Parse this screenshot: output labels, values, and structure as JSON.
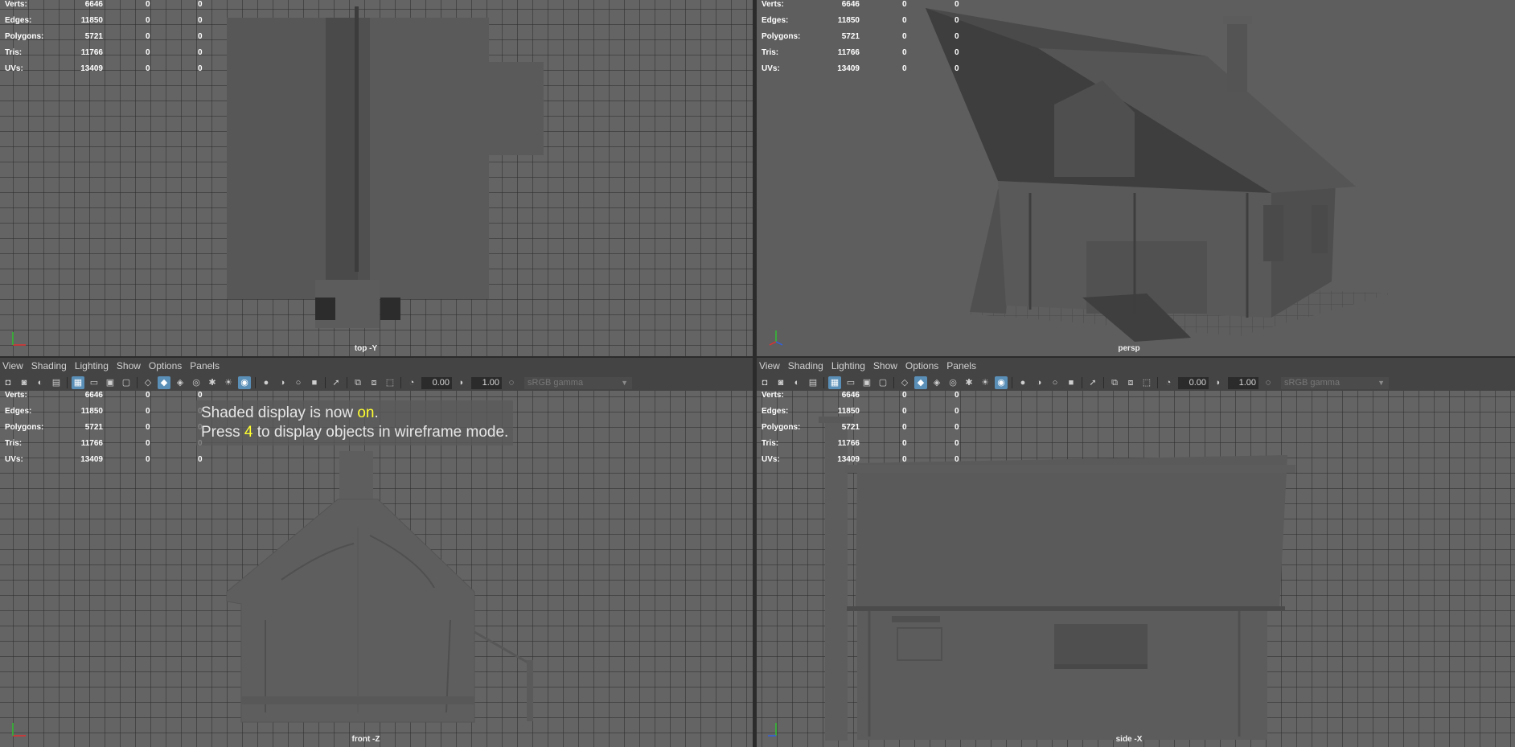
{
  "stats": {
    "rows": [
      {
        "label": "Verts:",
        "v1": "6646",
        "v2": "0",
        "v3": "0"
      },
      {
        "label": "Edges:",
        "v1": "11850",
        "v2": "0",
        "v3": "0"
      },
      {
        "label": "Polygons:",
        "v1": "5721",
        "v2": "0",
        "v3": "0"
      },
      {
        "label": "Tris:",
        "v1": "11766",
        "v2": "0",
        "v3": "0"
      },
      {
        "label": "UVs:",
        "v1": "13409",
        "v2": "0",
        "v3": "0"
      }
    ]
  },
  "viewports": {
    "top": {
      "camera_label": "top -Y"
    },
    "persp": {
      "camera_label": "persp"
    },
    "front": {
      "camera_label": "front -Z"
    },
    "side": {
      "camera_label": "side -X"
    }
  },
  "panel_menu": [
    "View",
    "Shading",
    "Lighting",
    "Show",
    "Options",
    "Panels"
  ],
  "toolbar": {
    "exposure": "0.00",
    "gamma": "1.00",
    "color_space": "sRGB gamma"
  },
  "notice": {
    "line1_prefix": "Shaded display is now ",
    "line1_highlight": "on",
    "line1_suffix": ".",
    "line2_prefix": "Press ",
    "line2_key": "4",
    "line2_suffix": " to display objects in wireframe mode."
  },
  "colors": {
    "active_button": "#5a8fb8",
    "notice_highlight": "#ffff30",
    "grid_background": "#646464"
  }
}
